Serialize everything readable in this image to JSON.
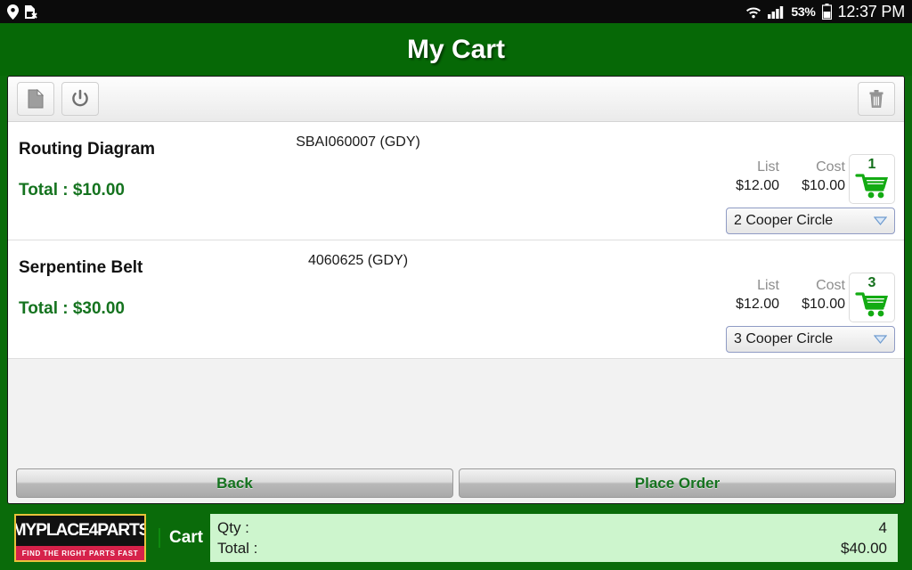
{
  "statusbar": {
    "icons_left": [
      "location-pin-icon",
      "sim-card-off-icon"
    ],
    "icons_right": [
      "wifi-icon",
      "cellular-signal-icon",
      "battery-icon"
    ],
    "battery_percent": "53%",
    "clock": "12:37 PM"
  },
  "titlebar": {
    "title": "My Cart"
  },
  "toolbar": {
    "document_button": "document-icon",
    "power_button": "power-icon",
    "delete_button": "trash-icon"
  },
  "items": [
    {
      "name": "Routing Diagram",
      "total": "Total : $10.00",
      "part_number": "SBAI060007 (GDY)",
      "list_label": "List",
      "cost_label": "Cost",
      "list_price": "$12.00",
      "cost_price": "$10.00",
      "qty": "1",
      "location": "2 Cooper Circle"
    },
    {
      "name": "Serpentine Belt",
      "total": "Total : $30.00",
      "part_number": "4060625 (GDY)",
      "list_label": "List",
      "cost_label": "Cost",
      "list_price": "$12.00",
      "cost_price": "$10.00",
      "qty": "3",
      "location": "3 Cooper Circle"
    }
  ],
  "actions": {
    "back_label": "Back",
    "place_order_label": "Place Order"
  },
  "bottombar": {
    "logo_main": "MYPLACE4PARTS",
    "logo_tagline": "FIND THE RIGHT PARTS FAST",
    "cart_label": "Cart",
    "qty_label": "Qty :",
    "qty_value": "4",
    "total_label": "Total :",
    "total_value": "$40.00"
  },
  "colors": {
    "brand_green": "#0a6b0a",
    "title_green": "#066806",
    "text_green": "#15731f",
    "summary_green": "#cdf5cd",
    "cart_icon_green": "#13ab13",
    "logo_red": "#d6224a",
    "logo_gold": "#e8c23a"
  }
}
